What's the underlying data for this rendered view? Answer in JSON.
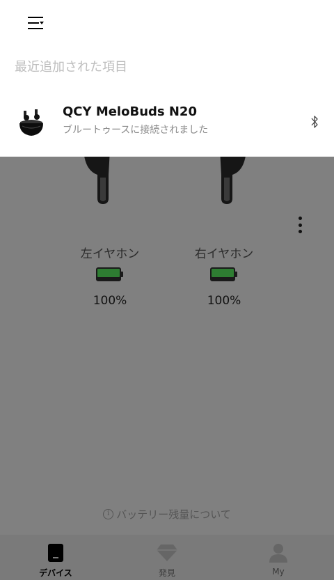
{
  "header": {
    "recent_title": "最近追加された項目"
  },
  "recent_devices": [
    {
      "name": "QCY MeloBuds N20",
      "status": "ブルートゥースに接続されました",
      "icon": "bluetooth-icon"
    }
  ],
  "earbuds": {
    "left": {
      "label": "左イヤホン",
      "battery_pct": "100%",
      "battery_level": 1.0
    },
    "right": {
      "label": "右イヤホン",
      "battery_pct": "100%",
      "battery_level": 1.0
    }
  },
  "battery_info": {
    "icon": "info-icon",
    "text": "バッテリー残量について"
  },
  "tabbar": {
    "tabs": [
      {
        "label": "デバイス",
        "icon": "device-icon",
        "active": true
      },
      {
        "label": "発見",
        "icon": "diamond-icon",
        "active": false
      },
      {
        "label": "My",
        "icon": "person-icon",
        "active": false
      }
    ]
  },
  "colors": {
    "battery_fill": "#2e7d32",
    "overlay_dim": "#808080",
    "sheet_bg": "#ffffff"
  }
}
